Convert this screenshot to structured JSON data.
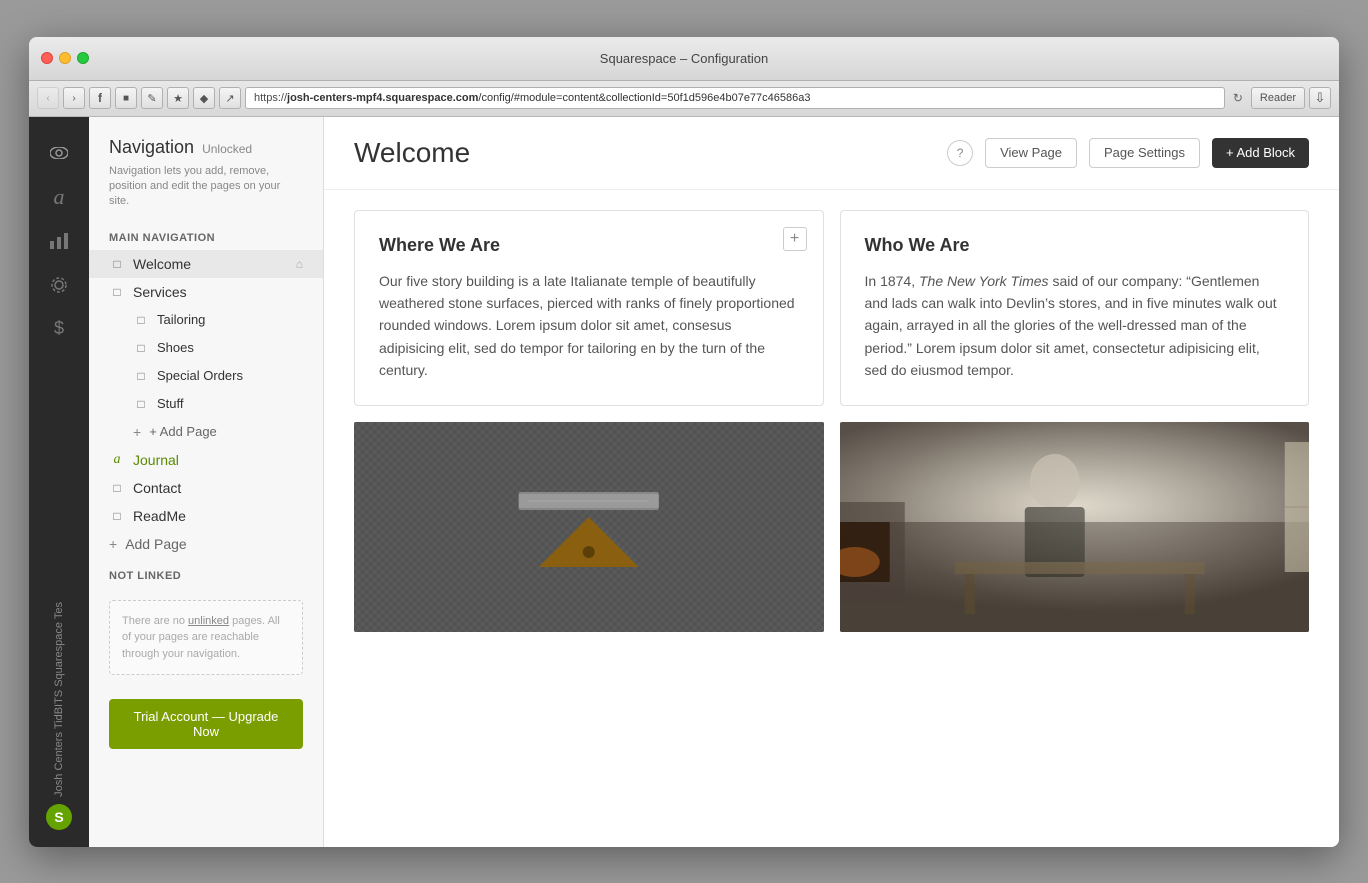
{
  "window": {
    "title": "Squarespace – Configuration",
    "traffic_lights": [
      "red",
      "yellow",
      "green"
    ]
  },
  "browser": {
    "url_secure": "https://",
    "url_domain": "josh-centers-mpf4.squarespace.com",
    "url_path": "/config/#module=content&collectionId=50f1d596e4b07e77c46586a3",
    "reader_label": "Reader"
  },
  "icon_sidebar": {
    "site_label": "Josh Centers TidBITS Squarespace Tes",
    "icons": [
      "eye",
      "type-a",
      "bar-chart",
      "gear",
      "dollar"
    ],
    "logo": "S"
  },
  "nav_panel": {
    "title": "Navigation",
    "unlocked_label": "Unlocked",
    "description": "Navigation lets you add, remove, position and edit the pages on your site.",
    "main_nav_label": "MAIN NAVIGATION",
    "items": [
      {
        "label": "Welcome",
        "active": true,
        "has_home_icon": true,
        "icon": "doc"
      },
      {
        "label": "Services",
        "icon": "doc",
        "children": [
          {
            "label": "Tailoring",
            "icon": "doc"
          },
          {
            "label": "Shoes",
            "icon": "doc"
          },
          {
            "label": "Special Orders",
            "icon": "doc"
          },
          {
            "label": "Stuff",
            "icon": "doc"
          }
        ]
      },
      {
        "label": "Journal",
        "icon": "journal"
      },
      {
        "label": "Contact",
        "icon": "doc"
      },
      {
        "label": "ReadMe",
        "icon": "doc"
      }
    ],
    "add_page_sub_label": "+ Add Page",
    "add_page_main_label": "+ Add Page",
    "not_linked_label": "NOT LINKED",
    "not_linked_text": "There are no unlinked pages. All of your pages are reachable through your navigation.",
    "upgrade_label": "Trial Account — Upgrade Now"
  },
  "main": {
    "page_title": "Welcome",
    "help_label": "?",
    "view_page_label": "View Page",
    "page_settings_label": "Page Settings",
    "add_block_label": "+ Add Block",
    "blocks": [
      {
        "id": "where-we-are",
        "title": "Where We Are",
        "text": "Our five story building is a late Italianate temple of beautifully weathered stone surfaces, pierced with ranks of finely proportioned rounded windows. Lorem ipsum dolor sit amet, consesus adipisicing elit, sed do tempor for tailoring en by the turn of the century.",
        "has_plus": true
      },
      {
        "id": "who-we-are",
        "title": "Who We Are",
        "text": "In 1874, The New York Times said of our company: \"Gentlemen and lads can walk into Devlin's stores, and in five minutes walk out again, arrayed in all the glories of the well-dressed man of the period.\" Lorem ipsum dolor sit amet, consectetur adipisicing elit, sed do eiusmod tempor.",
        "italic_phrase": "The New York Times"
      }
    ]
  }
}
